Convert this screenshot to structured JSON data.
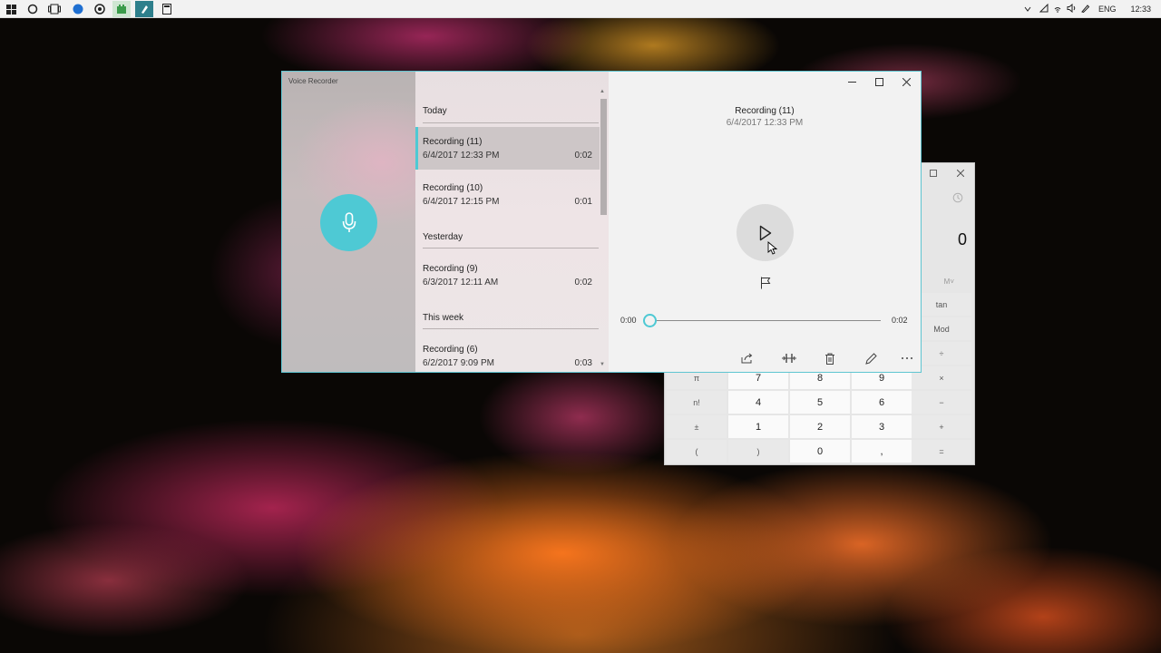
{
  "taskbar": {
    "language": "ENG",
    "clock": "12:33",
    "left_icons": [
      "windows-start-icon",
      "cortana-search-icon",
      "task-view-icon",
      "browser-icon",
      "chrome-icon",
      "app-icon",
      "pinned-app-icon",
      "calculator-taskbar-icon"
    ],
    "tray_icons": [
      "chevron-up-icon",
      "network-icon",
      "wifi-icon",
      "volume-icon",
      "pen-icon",
      "notifications-icon"
    ]
  },
  "voice_recorder": {
    "title": "Voice Recorder",
    "accent_color": "#4ec9d4",
    "groups": [
      {
        "header": "Today",
        "items": [
          {
            "name": "Recording (11)",
            "date": "6/4/2017 12:33 PM",
            "duration": "0:02",
            "selected": true
          },
          {
            "name": "Recording (10)",
            "date": "6/4/2017 12:15 PM",
            "duration": "0:01",
            "selected": false
          }
        ]
      },
      {
        "header": "Yesterday",
        "items": [
          {
            "name": "Recording (9)",
            "date": "6/3/2017 12:11 AM",
            "duration": "0:02",
            "selected": false
          }
        ]
      },
      {
        "header": "This week",
        "items": [
          {
            "name": "Recording (6)",
            "date": "6/2/2017 9:09 PM",
            "duration": "0:03",
            "selected": false
          }
        ]
      }
    ],
    "detail": {
      "title": "Recording (11)",
      "date": "6/4/2017 12:33 PM",
      "time_start": "0:00",
      "time_end": "0:02",
      "progress": 0
    },
    "toolbar": [
      "share-icon",
      "trim-icon",
      "delete-icon",
      "rename-icon",
      "more-icon"
    ]
  },
  "calculator": {
    "display": "0",
    "memory_label": "M˅",
    "keys": [
      [
        "",
        "",
        "",
        "",
        "tan"
      ],
      [
        "",
        "",
        "",
        "",
        "Mod"
      ],
      [
        "",
        "",
        "",
        "",
        "÷"
      ],
      [
        "π",
        "7",
        "8",
        "9",
        "×"
      ],
      [
        "n!",
        "4",
        "5",
        "6",
        "−"
      ],
      [
        "±",
        "1",
        "2",
        "3",
        "+"
      ],
      [
        "(",
        ")",
        "0",
        ",",
        "="
      ]
    ]
  }
}
